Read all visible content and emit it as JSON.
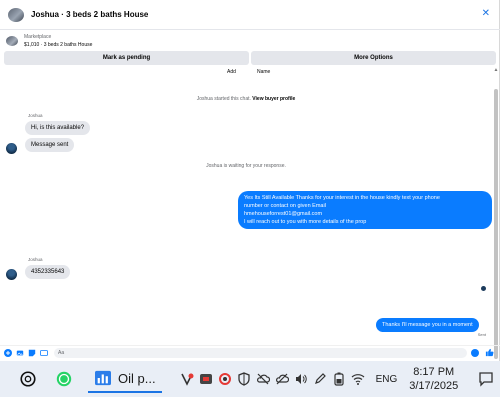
{
  "header": {
    "title": "Joshua · 3 beds 2 baths House",
    "close_icon": "close-x-icon"
  },
  "listing": {
    "kicker": "Marketplace",
    "description": "$1,010 · 3 beds 2 baths House"
  },
  "actions": {
    "pending_label": "Mark as pending",
    "more_label": "More Options"
  },
  "chat": {
    "add_text": "Add",
    "name_text": "Name",
    "started_text": "Joshua started this chat.",
    "view_profile_text": "View buyer profile",
    "waiting_text": "Joshua is waiting for your response.",
    "sender_1": "Joshua",
    "sender_2": "Joshua",
    "in_msg_1": "Hi, is this available?",
    "in_msg_2": "Message sent",
    "in_msg_3": "4352335643",
    "out_msg_1_line1": "Yes Its Still Available Thanks for your interest in the house kindly  text your phone",
    "out_msg_1_line2": "number or contact on given  Email",
    "out_msg_1_line3": "hmehouseforrest01@gmail.com",
    "out_msg_1_line4": "I will reach out to you with more details of the prop",
    "out_msg_2": "Thanks I'll message you in a moment",
    "sent_text": "Sent"
  },
  "composer": {
    "placeholder": "Aa"
  },
  "taskbar": {
    "app_label": "Oil p...",
    "lang": "ENG",
    "time": "8:17 PM",
    "date": "3/17/2025"
  },
  "colors": {
    "messenger_blue": "#0a7cff",
    "bubble_gray": "#e4e6eb",
    "taskbar_bg": "#e9eef6"
  }
}
